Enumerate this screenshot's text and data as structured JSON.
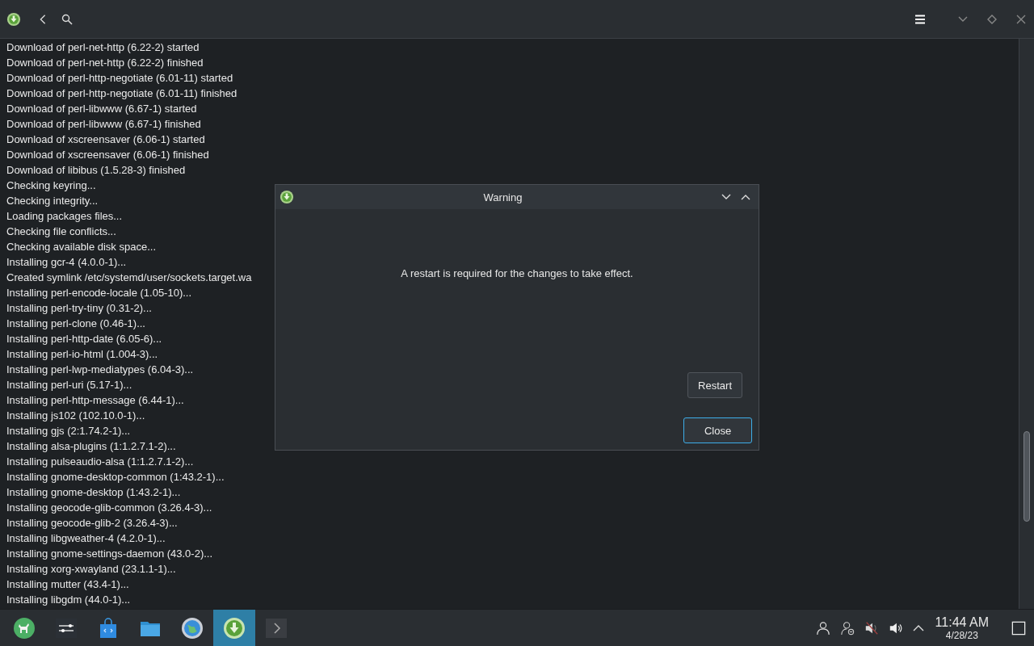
{
  "log": [
    "Download of perl-net-http (6.22-2) started",
    "Download of perl-net-http (6.22-2) finished",
    "Download of perl-http-negotiate (6.01-11) started",
    "Download of perl-http-negotiate (6.01-11) finished",
    "Download of perl-libwww (6.67-1) started",
    "Download of perl-libwww (6.67-1) finished",
    "Download of xscreensaver (6.06-1) started",
    "Download of xscreensaver (6.06-1) finished",
    "Download of libibus (1.5.28-3) finished",
    "Checking keyring...",
    "Checking integrity...",
    "Loading packages files...",
    "Checking file conflicts...",
    "Checking available disk space...",
    "Installing gcr-4 (4.0.0-1)...",
    "Created symlink /etc/systemd/user/sockets.target.wa",
    "Installing perl-encode-locale (1.05-10)...",
    "Installing perl-try-tiny (0.31-2)...",
    "Installing perl-clone (0.46-1)...",
    "Installing perl-http-date (6.05-6)...",
    "Installing perl-io-html (1.004-3)...",
    "Installing perl-lwp-mediatypes (6.04-3)...",
    "Installing perl-uri (5.17-1)...",
    "Installing perl-http-message (6.44-1)...",
    "Installing js102 (102.10.0-1)...",
    "Installing gjs (2:1.74.2-1)...",
    "Installing alsa-plugins (1:1.2.7.1-2)...",
    "Installing pulseaudio-alsa (1:1.2.7.1-2)...",
    "Installing gnome-desktop-common (1:43.2-1)...",
    "Installing gnome-desktop (1:43.2-1)...",
    "Installing geocode-glib-common (3.26.4-3)...",
    "Installing geocode-glib-2 (3.26.4-3)...",
    "Installing libgweather-4 (4.2.0-1)...",
    "Installing gnome-settings-daemon (43.0-2)...",
    "Installing xorg-xwayland (23.1.1-1)...",
    "Installing mutter (43.4-1)...",
    "Installing libgdm (44.0-1)..."
  ],
  "dialog": {
    "title": "Warning",
    "message": "A restart is required for the changes to take effect.",
    "buttons": [
      {
        "label": "Restart",
        "focused": false
      },
      {
        "label": "Close",
        "focused": true
      }
    ]
  },
  "taskbar": {
    "items": [
      {
        "kind": "launcher",
        "selected": false
      },
      {
        "kind": "settings",
        "selected": false
      },
      {
        "kind": "store",
        "selected": false
      },
      {
        "kind": "files",
        "selected": false
      },
      {
        "kind": "browser",
        "selected": false
      },
      {
        "kind": "updater",
        "selected": true
      },
      {
        "kind": "terminal",
        "selected": false
      }
    ],
    "time": "11:44 AM",
    "date": "4/28/23"
  }
}
